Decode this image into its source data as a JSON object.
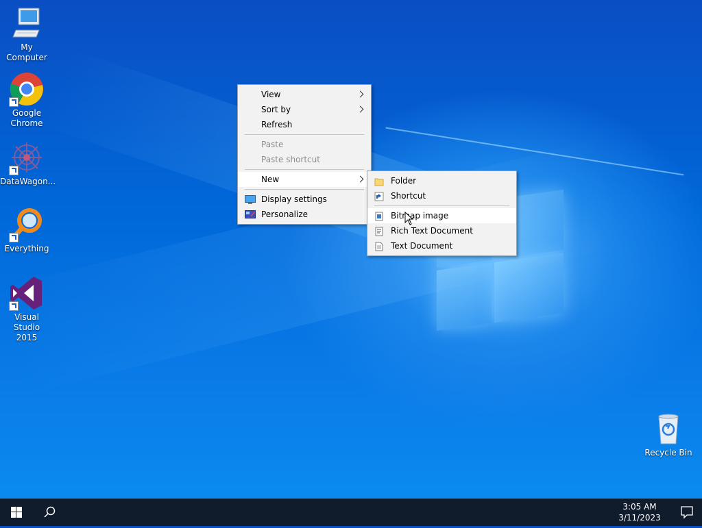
{
  "desktop": {
    "icons": [
      {
        "label": "My Computer"
      },
      {
        "label": "Google Chrome"
      },
      {
        "label": "DataWagon..."
      },
      {
        "label": "Everything"
      },
      {
        "label": "Visual Studio 2015"
      },
      {
        "label": "Recycle Bin"
      }
    ]
  },
  "context_menu": {
    "items": [
      {
        "label": "View",
        "has_submenu": true
      },
      {
        "label": "Sort by",
        "has_submenu": true
      },
      {
        "label": "Refresh"
      },
      {
        "label": "Paste",
        "disabled": true
      },
      {
        "label": "Paste shortcut",
        "disabled": true
      },
      {
        "label": "New",
        "has_submenu": true,
        "highlighted": true
      },
      {
        "label": "Display settings",
        "icon": "display-settings-icon"
      },
      {
        "label": "Personalize",
        "icon": "personalize-icon"
      }
    ]
  },
  "new_submenu": {
    "items": [
      {
        "label": "Folder",
        "icon": "folder-icon"
      },
      {
        "label": "Shortcut",
        "icon": "shortcut-icon"
      },
      {
        "label": "Bitmap image",
        "icon": "bitmap-icon",
        "highlighted": true
      },
      {
        "label": "Rich Text Document",
        "icon": "rich-text-icon"
      },
      {
        "label": "Text Document",
        "icon": "text-document-icon"
      }
    ]
  },
  "taskbar": {
    "time": "3:05 AM",
    "date": "3/11/2023"
  },
  "colors": {
    "taskbar": "#101b2b",
    "menu_bg": "#f2f2f2",
    "accent": "#0078d7"
  }
}
